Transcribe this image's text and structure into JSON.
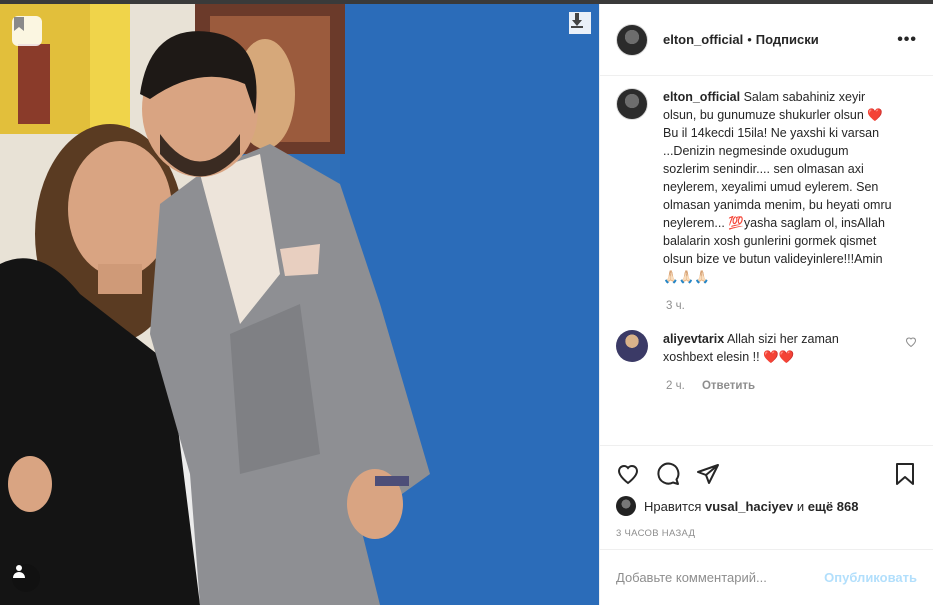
{
  "post": {
    "author": "elton_official",
    "follow_state": "Подписки",
    "more_icon": "more-horizontal-icon",
    "caption_user": "elton_official",
    "caption": "Salam sabahiniz xeyir olsun, bu gunumuze shukurler olsun ❤️ Bu il 14kecdi 15ila! Ne yaxshi ki varsan ...Denizin negmesinde oxudugum sozlerim senindir.... sen olmasan axi neylerem, xeyalimi umud eylerem. Sen olmasan yanimda menim, bu heyati omru neylerem... 💯yasha saglam ol, insAllah balalarin xosh gunlerini gormek qismet olsun bize ve butun valideyinlere!!!Amin 🙏🏻🙏🏻🙏🏻",
    "caption_time": "3 ч."
  },
  "comments": [
    {
      "user": "aliyevtarix",
      "text": "Allah sizi her zaman xoshbext elesin !! ❤️❤️",
      "time": "2 ч.",
      "reply_label": "Ответить"
    }
  ],
  "likes": {
    "prefix": "Нравится",
    "user": "vusal_haciyev",
    "middle": "и",
    "more": "ещё 868"
  },
  "posted_ago": "3 часов назад",
  "add_comment": {
    "placeholder": "Добавьте комментарий...",
    "submit_label": "Опубликовать"
  },
  "colors": {
    "accent": "#0095f6",
    "publish_disabled": "#b2dffc",
    "wall_blue": "#2f6fb8"
  },
  "icons": [
    "bookmark-icon",
    "download-icon",
    "user-tag-icon",
    "heart-icon",
    "comment-icon",
    "share-icon",
    "save-icon"
  ]
}
